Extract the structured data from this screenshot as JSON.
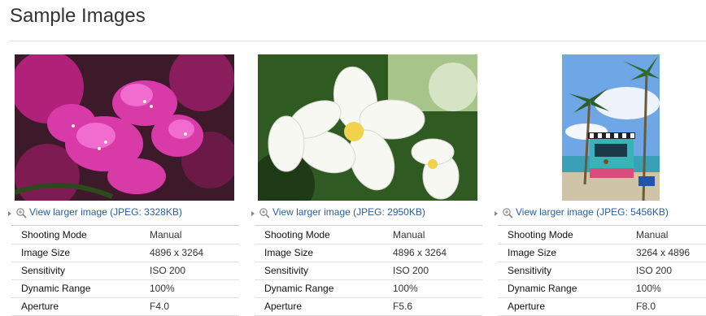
{
  "page": {
    "title": "Sample Images"
  },
  "images": [
    {
      "subject": "pink bougainvillea flowers",
      "link_text": "View larger image (JPEG: 3328KB)",
      "specs": [
        {
          "key": "Shooting Mode",
          "value": "Manual"
        },
        {
          "key": "Image Size",
          "value": "4896 x 3264"
        },
        {
          "key": "Sensitivity",
          "value": "ISO 200"
        },
        {
          "key": "Dynamic Range",
          "value": "100%"
        },
        {
          "key": "Aperture",
          "value": "F4.0"
        }
      ]
    },
    {
      "subject": "white plumeria flowers",
      "link_text": "View larger image (JPEG: 2950KB)",
      "specs": [
        {
          "key": "Shooting Mode",
          "value": "Manual"
        },
        {
          "key": "Image Size",
          "value": "4896 x 3264"
        },
        {
          "key": "Sensitivity",
          "value": "ISO 200"
        },
        {
          "key": "Dynamic Range",
          "value": "100%"
        },
        {
          "key": "Aperture",
          "value": "F5.6"
        }
      ]
    },
    {
      "subject": "beach kiosk with palm trees",
      "link_text": "View larger image (JPEG: 5456KB)",
      "specs": [
        {
          "key": "Shooting Mode",
          "value": "Manual"
        },
        {
          "key": "Image Size",
          "value": "3264 x 4896"
        },
        {
          "key": "Sensitivity",
          "value": "ISO 200"
        },
        {
          "key": "Dynamic Range",
          "value": "100%"
        },
        {
          "key": "Aperture",
          "value": "F8.0"
        }
      ]
    }
  ],
  "colors": {
    "link": "#2a5d9f",
    "rule": "#e3e3e3"
  },
  "icons": {
    "zoom": "magnifier-plus-icon",
    "bullet": "triangle-right-icon"
  }
}
